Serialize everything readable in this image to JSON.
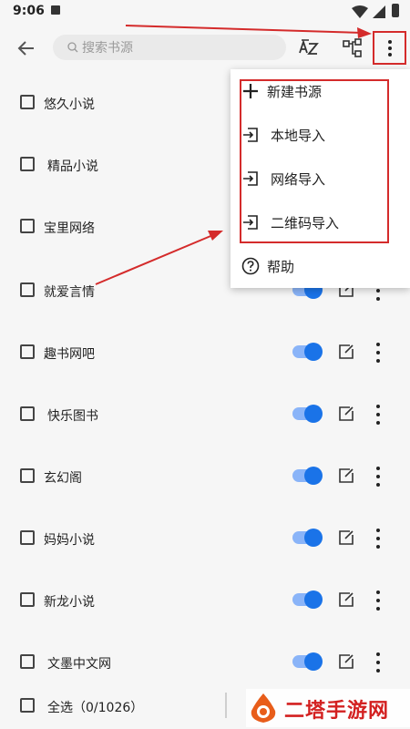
{
  "status_bar": {
    "time": "9:06"
  },
  "toolbar": {
    "search_placeholder": "搜索书源"
  },
  "sources": [
    {
      "name": "悠久小说"
    },
    {
      "name": "精品小说"
    },
    {
      "name": "宝里网络"
    },
    {
      "name": "就爱言情"
    },
    {
      "name": "趣书网吧"
    },
    {
      "name": "快乐图书"
    },
    {
      "name": "玄幻阁"
    },
    {
      "name": "妈妈小说"
    },
    {
      "name": "新龙小说"
    },
    {
      "name": "文墨中文网"
    }
  ],
  "bottom": {
    "select_all": "全选（0/1026）"
  },
  "menu": {
    "items": [
      {
        "label": "新建书源",
        "icon": "plus-icon"
      },
      {
        "label": "本地导入",
        "icon": "import-icon"
      },
      {
        "label": "网络导入",
        "icon": "import-icon"
      },
      {
        "label": "二维码导入",
        "icon": "import-icon"
      },
      {
        "label": "帮助",
        "icon": "help-icon"
      }
    ]
  },
  "watermark": {
    "text": "二塔手游网"
  },
  "colors": {
    "accent": "#1a73e8",
    "toggle_track": "#8ab4f8",
    "annotation": "#d42b2b"
  }
}
